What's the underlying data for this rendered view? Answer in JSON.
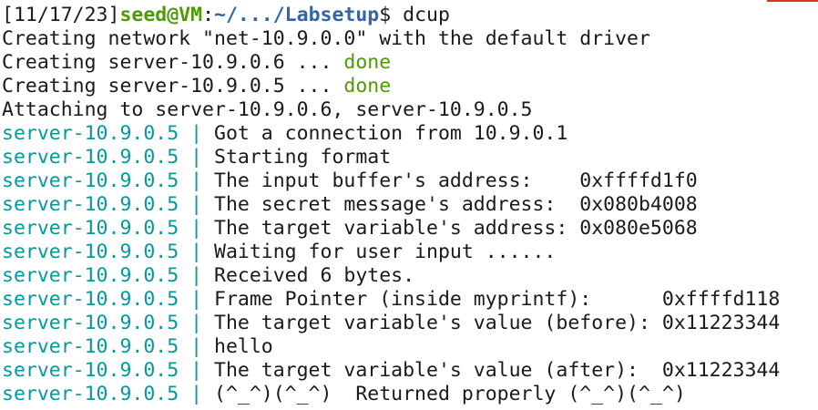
{
  "colors": {
    "background": "#ffffff",
    "text": "#1a1a1a",
    "prompt_user": "#4e9a06",
    "prompt_path": "#3465a4",
    "done": "#4e9a06",
    "service_prefix": "#06989a",
    "accent_rule": "#d6390f"
  },
  "prompt": {
    "date": "[11/17/23]",
    "user_host": "seed@VM",
    "separator": ":",
    "path": "~/.../Labsetup",
    "dollar": "$ ",
    "command": "dcup"
  },
  "compose_output": [
    {
      "text": "Creating network \"net-10.9.0.0\" with the default driver",
      "status": ""
    },
    {
      "text": "Creating server-10.9.0.6 ... ",
      "status": "done"
    },
    {
      "text": "Creating server-10.9.0.5 ... ",
      "status": "done"
    },
    {
      "text": "Attaching to server-10.9.0.6, server-10.9.0.5",
      "status": ""
    }
  ],
  "service_prefix": "server-10.9.0.5 | ",
  "log_lines": [
    "Got a connection from 10.9.0.1",
    "Starting format",
    "The input buffer's address:    0xffffd1f0",
    "The secret message's address:  0x080b4008",
    "The target variable's address: 0x080e5068",
    "Waiting for user input ......",
    "Received 6 bytes.",
    "Frame Pointer (inside myprintf):      0xffffd118",
    "The target variable's value (before): 0x11223344",
    "hello",
    "The target variable's value (after):  0x11223344",
    "(^_^)(^_^)  Returned properly (^_^)(^_^)"
  ]
}
